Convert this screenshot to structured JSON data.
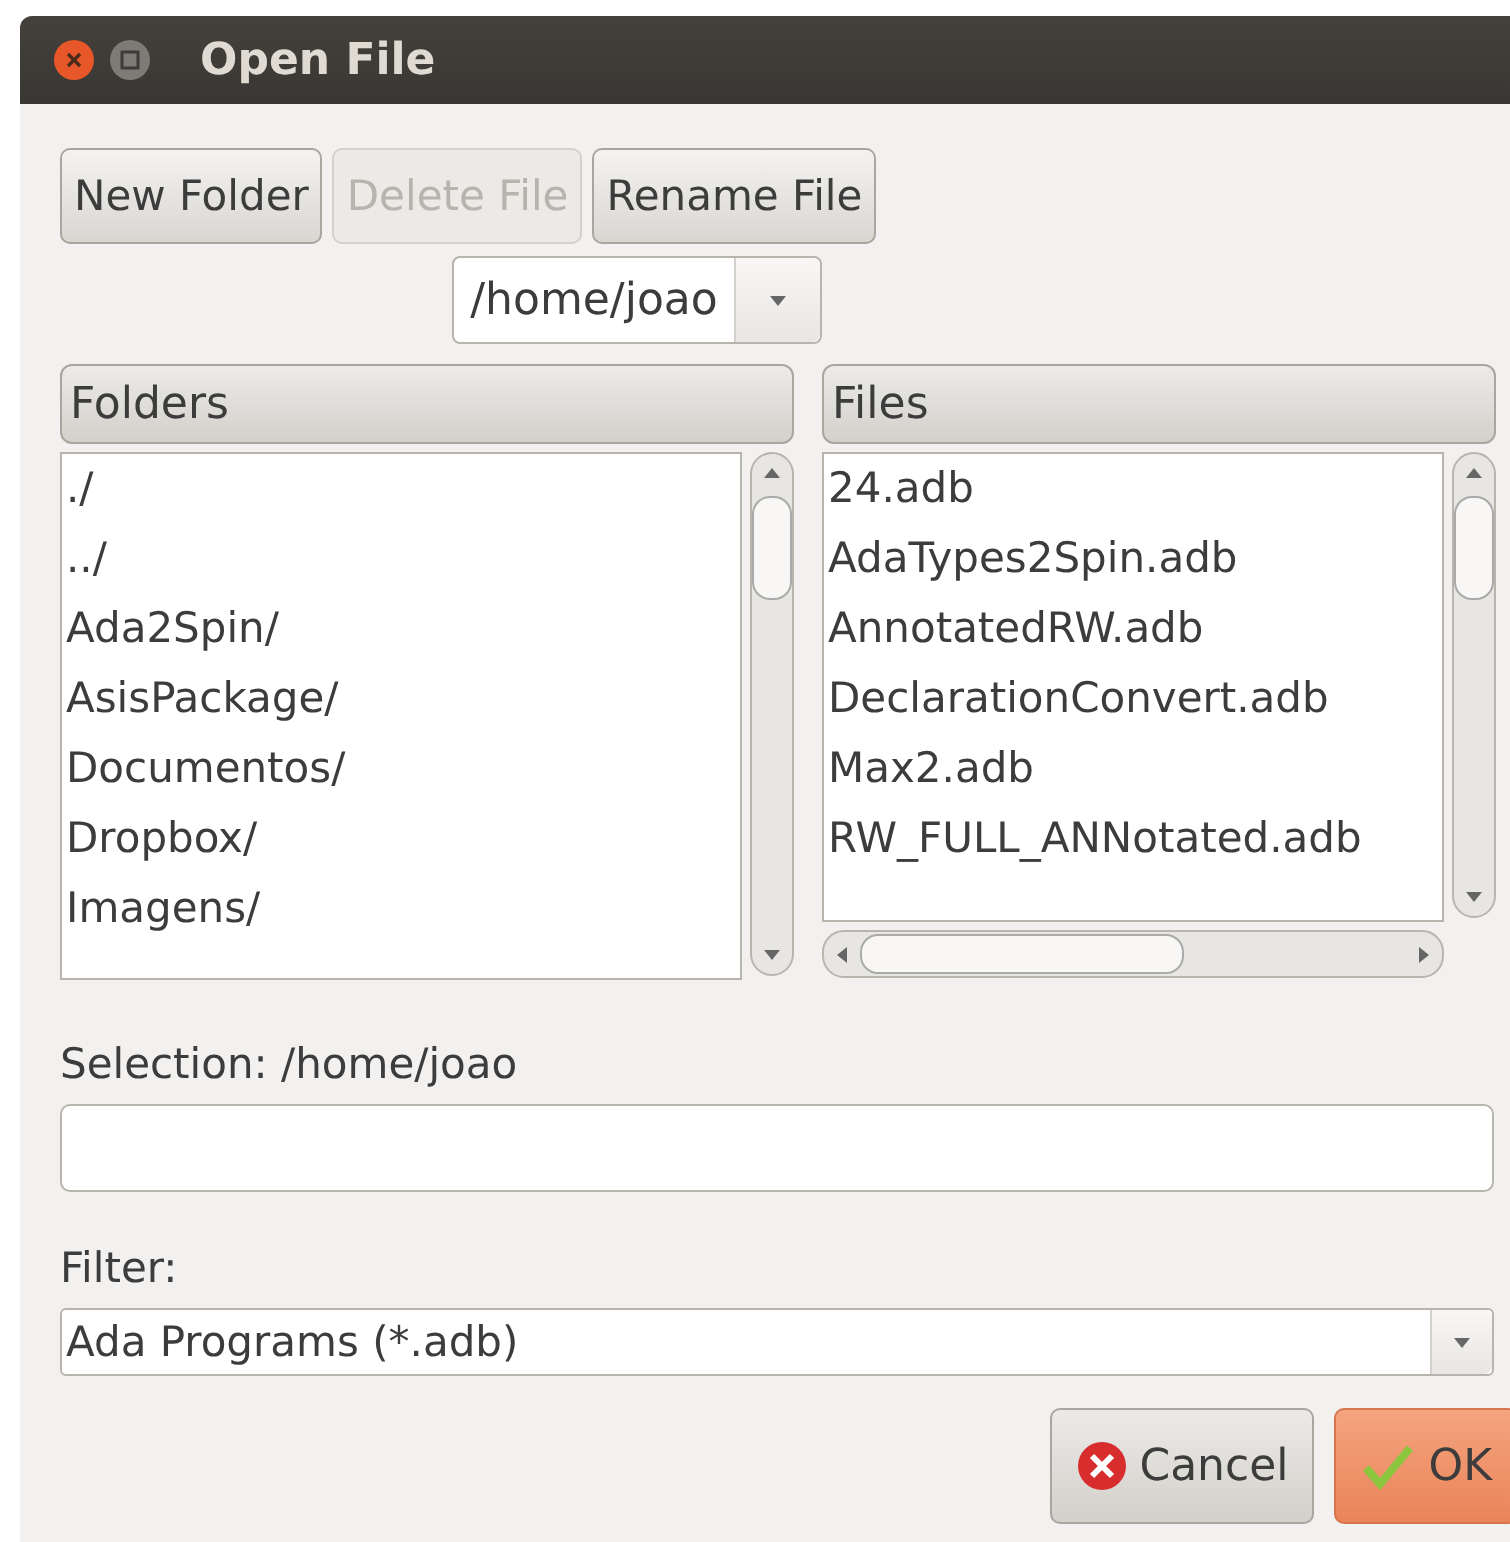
{
  "window": {
    "title": "Open File"
  },
  "toolbar": [
    {
      "label": "New Folder",
      "disabled": false
    },
    {
      "label": "Delete File",
      "disabled": true
    },
    {
      "label": "Rename File",
      "disabled": false
    }
  ],
  "path_combo": {
    "value": "/home/joao"
  },
  "folders": {
    "header": "Folders",
    "items": [
      "./",
      "../",
      "Ada2Spin/",
      "AsisPackage/",
      "Documentos/",
      "Dropbox/",
      "Imagens/"
    ]
  },
  "files": {
    "header": "Files",
    "items": [
      "24.adb",
      "AdaTypes2Spin.adb",
      "AnnotatedRW.adb",
      "DeclarationConvert.adb",
      "Max2.adb",
      "RW_FULL_ANNotated.adb"
    ]
  },
  "selection": {
    "label": "Selection: /home/joao"
  },
  "filter": {
    "label": "Filter:",
    "value": "Ada Programs (*.adb)"
  },
  "buttons": [
    {
      "label": "Cancel",
      "kind": "cancel"
    },
    {
      "label": "OK",
      "kind": "ok"
    }
  ]
}
